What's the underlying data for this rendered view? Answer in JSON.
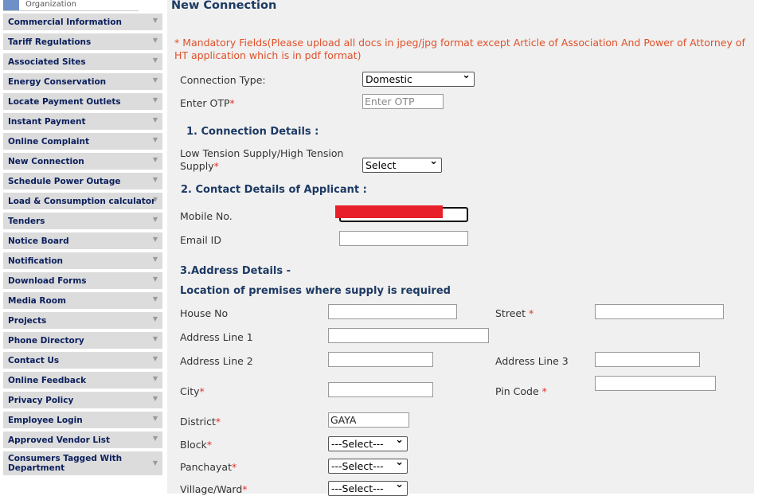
{
  "sidebar": {
    "org_label": "Organization",
    "items": [
      "Commercial Information",
      "Tariff Regulations",
      "Associated Sites",
      "Energy Conservation",
      "Locate Payment Outlets",
      "Instant Payment",
      "Online Complaint",
      "New Connection",
      "Schedule Power Outage",
      "Load & Consumption calculator",
      "Tenders",
      "Notice Board",
      "Notification",
      "Download Forms",
      "Media Room",
      "Projects",
      "Phone Directory",
      "Contact Us",
      "Online Feedback",
      "Privacy Policy",
      "Employee Login",
      "Approved Vendor List",
      "Consumers Tagged With Department"
    ]
  },
  "page": {
    "title": "New Connection",
    "mandatory_note": "* Mandatory Fields(Please upload all docs in jpeg/jpg format except Article of Association And Power of Attorney of HT application which is in pdf format)"
  },
  "form": {
    "connection_type_label": "Connection Type:",
    "connection_type_value": "Domestic",
    "otp_label": "Enter OTP",
    "otp_placeholder": "Enter OTP",
    "sec1": "1. Connection Details   :",
    "supply_label": "Low Tension Supply/High Tension Supply",
    "supply_value": "Select",
    "sec2": "2. Contact Details of Applicant  :",
    "mobile_label": "Mobile No.",
    "email_label": "Email ID",
    "sec3": "3.Address Details -",
    "location_heading": "Location of premises where supply is required",
    "house_label": "House No",
    "street_label": "Street",
    "addr1_label": "Address Line 1",
    "addr2_label": "Address Line 2",
    "addr3_label": "Address Line 3",
    "city_label": "City",
    "pin_label": "Pin Code",
    "district_label": "District",
    "district_value": "GAYA",
    "block_label": "Block",
    "block_value": "---Select---",
    "panchayat_label": "Panchayat",
    "panchayat_value": "---Select---",
    "village_label": "Village/Ward",
    "village_value": "---Select---",
    "asterisk": "*"
  }
}
